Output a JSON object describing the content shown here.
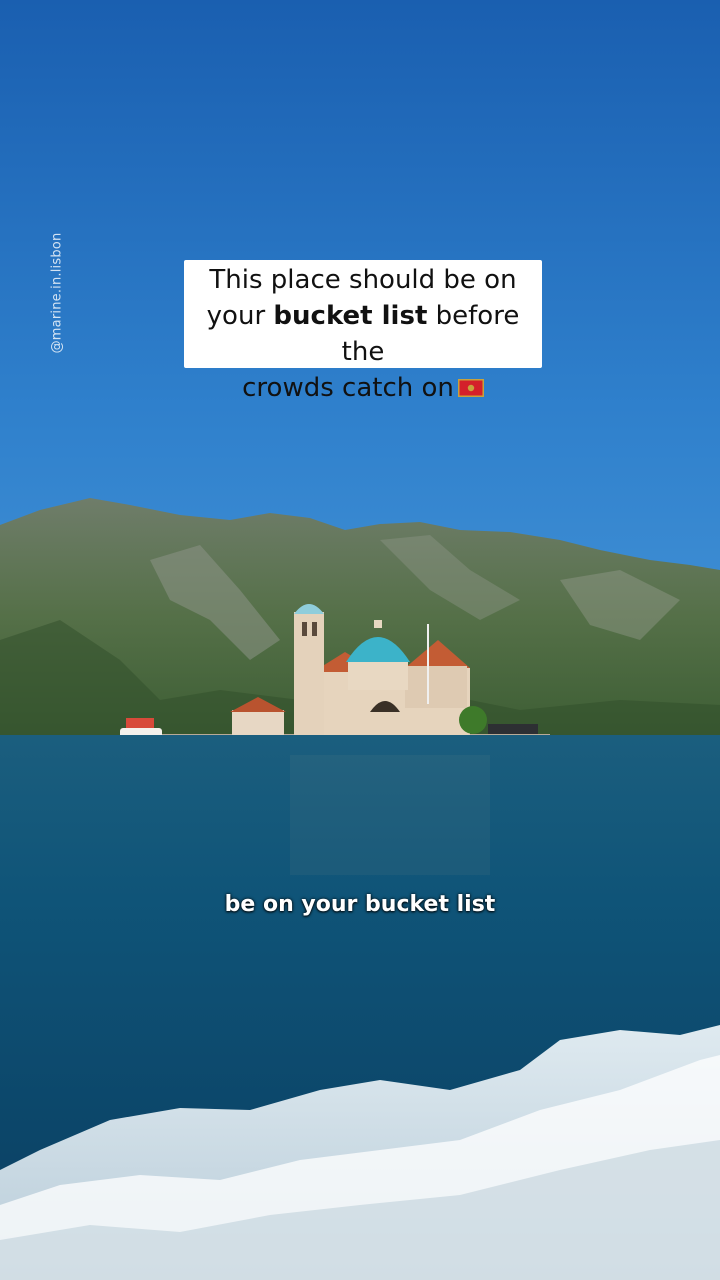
{
  "caption": {
    "line1": "This place should be on",
    "line2_pre": "your ",
    "line2_bold": "bucket list",
    "line2_post": " before the",
    "line3": "crowds catch on"
  },
  "flag_icon": "montenegro-flag-icon",
  "watermark": "@marine.in.lisbon",
  "subtitle": "be on your bucket list",
  "colors": {
    "sky_top": "#1a5fb0",
    "sky_bottom": "#3f93d6",
    "water": "#0d4f78",
    "dome": "#3cb3c9",
    "caption_bg": "#ffffff"
  }
}
